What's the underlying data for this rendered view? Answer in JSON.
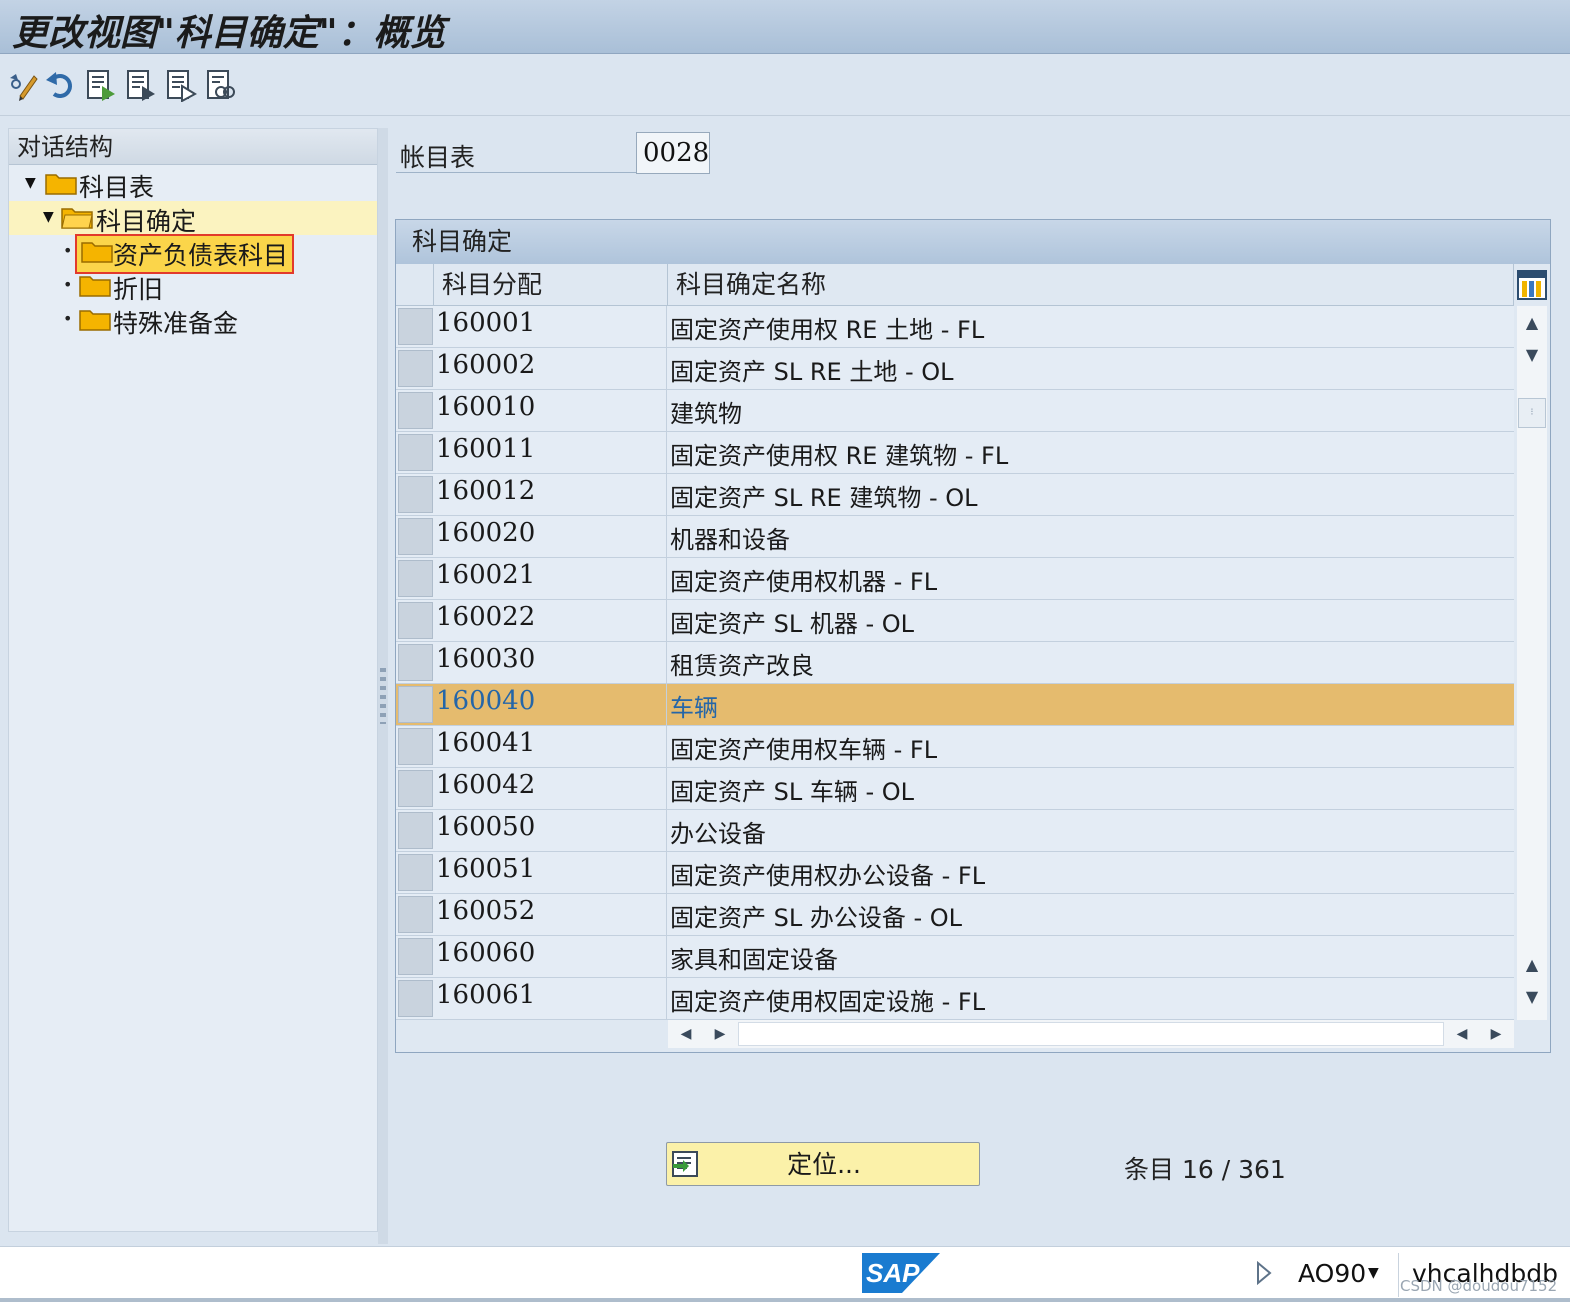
{
  "window": {
    "title": "更改视图\"科目确定\"：概览"
  },
  "toolbar": {
    "icons": [
      "display-change-icon",
      "undo-icon",
      "new-entries-icon",
      "copy-as-icon",
      "delete-icon",
      "select-all-icon"
    ]
  },
  "dialog_structure": {
    "header": "对话结构",
    "items": [
      {
        "label": "科目表",
        "level": 1,
        "expanded": true
      },
      {
        "label": "科目确定",
        "level": 2,
        "expanded": true
      },
      {
        "label": "资产负债表科目",
        "level": 3,
        "selected": true
      },
      {
        "label": "折旧",
        "level": 3
      },
      {
        "label": "特殊准备金",
        "level": 3
      }
    ]
  },
  "chart_of_accounts": {
    "label": "帐目表",
    "value": "0028"
  },
  "table": {
    "caption": "科目确定",
    "columns": [
      "科目分配",
      "科目确定名称"
    ],
    "rows": [
      {
        "code": "160001",
        "name": "固定资产使用权 RE 土地 - FL"
      },
      {
        "code": "160002",
        "name": "固定资产 SL RE 土地 - OL"
      },
      {
        "code": "160010",
        "name": "建筑物"
      },
      {
        "code": "160011",
        "name": "固定资产使用权 RE 建筑物 - FL"
      },
      {
        "code": "160012",
        "name": "固定资产 SL RE 建筑物 - OL"
      },
      {
        "code": "160020",
        "name": "机器和设备"
      },
      {
        "code": "160021",
        "name": "固定资产使用权机器 - FL"
      },
      {
        "code": "160022",
        "name": "固定资产 SL 机器 - OL"
      },
      {
        "code": "160030",
        "name": "租赁资产改良"
      },
      {
        "code": "160040",
        "name": "车辆",
        "highlighted": true
      },
      {
        "code": "160041",
        "name": "固定资产使用权车辆 - FL"
      },
      {
        "code": "160042",
        "name": "固定资产 SL 车辆 - OL"
      },
      {
        "code": "160050",
        "name": "办公设备"
      },
      {
        "code": "160051",
        "name": "固定资产使用权办公设备 - FL"
      },
      {
        "code": "160052",
        "name": "固定资产 SL 办公设备 - OL"
      },
      {
        "code": "160060",
        "name": "家具和固定设备"
      },
      {
        "code": "160061",
        "name": "固定资产使用权固定设施 - FL"
      }
    ]
  },
  "position_button": {
    "label": "定位..."
  },
  "entries": {
    "label": "条目",
    "value": "16 / 361"
  },
  "status_bar": {
    "logo": "SAP",
    "transaction": "AO90",
    "server": "vhcalhdbdb",
    "watermark": "CSDN @doudou7152"
  },
  "colors": {
    "highlight_row": "#e5bb6e",
    "highlight_text": "#2566a8",
    "selected_node_border": "#e23a2c",
    "folder": "#f5b400"
  }
}
